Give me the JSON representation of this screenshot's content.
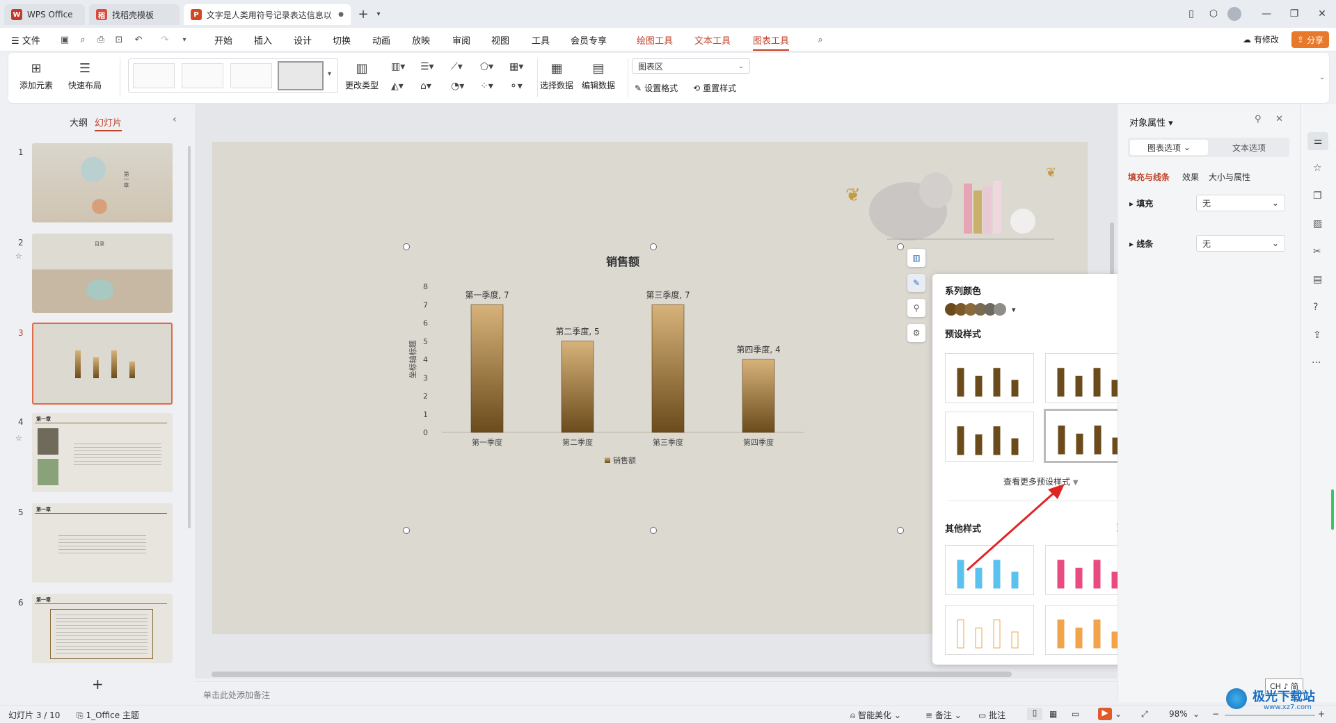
{
  "tabs": [
    {
      "label": "WPS Office"
    },
    {
      "label": "找稻壳模板"
    },
    {
      "label": "文字是人类用符号记录表达信息以"
    }
  ],
  "menu": {
    "file": "文件",
    "items": [
      "开始",
      "插入",
      "设计",
      "切换",
      "动画",
      "放映",
      "审阅",
      "视图",
      "工具",
      "会员专享"
    ],
    "context": [
      "绘图工具",
      "文本工具",
      "图表工具"
    ],
    "modify": "有修改",
    "share": "分享"
  },
  "ribbon": {
    "add_element": "添加元素",
    "quick_layout": "快速布局",
    "change_type": "更改类型",
    "select_data": "选择数据",
    "edit_data": "编辑数据",
    "area_select": "图表区",
    "set_format": "设置格式",
    "reset_style": "重置样式"
  },
  "leftpanel": {
    "outline": "大纲",
    "slides": "幻灯片",
    "numbers": [
      "1",
      "2",
      "3",
      "4",
      "5",
      "6"
    ],
    "add": "+",
    "s2_title": "目录",
    "s4_title": "第一章",
    "s5_title": "第一章",
    "s6_title": "第一章",
    "s1_title": "第一章"
  },
  "chart_data": {
    "type": "bar",
    "title": "销售额",
    "categories": [
      "第一季度",
      "第二季度",
      "第三季度",
      "第四季度"
    ],
    "values": [
      7,
      5,
      7,
      4
    ],
    "data_labels": [
      "第一季度, 7",
      "第二季度, 5",
      "第三季度, 7",
      "第四季度, 4"
    ],
    "ylabel": "坐标轴标题",
    "ylim": [
      0,
      8
    ],
    "yticks": [
      "0",
      "1",
      "2",
      "3",
      "4",
      "5",
      "6",
      "7",
      "8"
    ],
    "legend": "销售额",
    "legend_position": "bottom",
    "grid": false
  },
  "popup": {
    "series_color": "系列颜色",
    "preset": "预设样式",
    "more_preset": "查看更多预设样式",
    "other": "其他样式",
    "more": "更多"
  },
  "rightpanel": {
    "title": "对象属性",
    "tab_chart": "图表选项",
    "tab_text": "文本选项",
    "sub_fill": "填充与线条",
    "sub_effect": "效果",
    "sub_size": "大小与属性",
    "fill": "填充",
    "line": "线条",
    "fill_val": "无",
    "line_val": "无"
  },
  "notes": {
    "placeholder": "单击此处添加备注"
  },
  "status": {
    "slide": "幻灯片 3 / 10",
    "theme": "1_Office 主题",
    "beautify": "智能美化",
    "notes": "备注",
    "comment": "批注",
    "zoom": "98%",
    "ime": "CH ♪ 简",
    "watermark": "极光下载站",
    "watermark_url": "www.xz7.com"
  },
  "colors": {
    "accent": "#c0442a",
    "bar_top": "#d7b37a",
    "bar_bottom": "#6b4b1c"
  }
}
